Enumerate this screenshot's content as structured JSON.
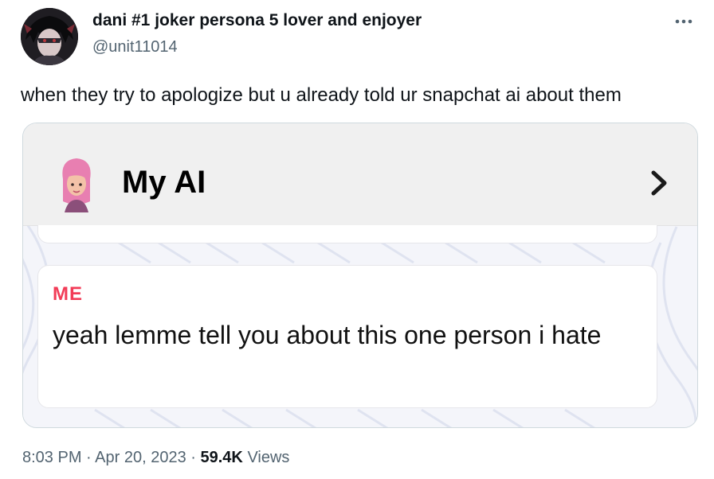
{
  "author": {
    "display_name": "dani #1 joker persona 5 lover and enjoyer",
    "handle": "@unit11014"
  },
  "tweet": {
    "text": "when they try to apologize but u already told ur snapchat ai about them",
    "time": "8:03 PM",
    "date": "Apr 20, 2023",
    "separator": "·",
    "views_count": "59.4K",
    "views_label": "Views"
  },
  "media": {
    "chat_title": "My AI",
    "message": {
      "sender": "ME",
      "text": "yeah lemme tell you about this one person i hate"
    }
  },
  "icons": {
    "more": "more-horizontal-icon",
    "chevron": "chevron-right-icon",
    "avatar": "profile-avatar",
    "bitmoji": "my-ai-bitmoji"
  },
  "colors": {
    "text_primary": "#0f1419",
    "text_secondary": "#536471",
    "sender_red": "#f23c57",
    "card_border": "#cfd9de"
  }
}
